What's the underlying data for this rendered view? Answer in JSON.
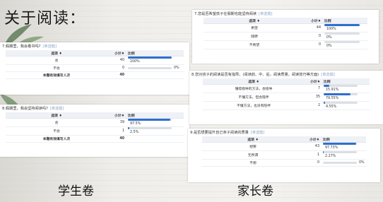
{
  "title": "关于阅读：",
  "captions": {
    "student": "学生卷",
    "parent": "家长卷"
  },
  "student": {
    "q7": {
      "question": "7.假期里，我会看书吗?",
      "tag": "[单选题]",
      "headers": [
        "选项 ♦",
        "小计♦",
        "比例"
      ],
      "rows": [
        {
          "option": "会",
          "count": "40",
          "pct_label": "100%",
          "pct": 100
        },
        {
          "option": "不会",
          "count": "0",
          "pct_label": "0%",
          "pct": 0
        }
      ],
      "total": {
        "label": "本题有效填写人次",
        "count": "40"
      }
    },
    "q8": {
      "question": "8.假期里，我会坚持阅读吗?",
      "tag": "[单选题]",
      "headers": [
        "选项 ♦",
        "小计♦",
        "比例"
      ],
      "rows": [
        {
          "option": "会",
          "count": "39",
          "pct_label": "97.5%",
          "pct": 97.5
        },
        {
          "option": "不会",
          "count": "1",
          "pct_label": "2.5%",
          "pct": 2.5
        }
      ],
      "total": {
        "label": "本题有效填写人次",
        "count": "40"
      }
    }
  },
  "parent": {
    "q7": {
      "question": "7.您是否希望孩子在假期也能坚持阅读",
      "tag": "[单选题]",
      "headers": [
        "选项 ♦",
        "小计♦",
        "比例"
      ],
      "rows": [
        {
          "option": "希望",
          "count": "44",
          "pct_label": "100%",
          "pct": 100
        },
        {
          "option": "随便",
          "count": "0",
          "pct_label": "0%",
          "pct": 0
        },
        {
          "option": "不希望",
          "count": "0",
          "pct_label": "0%",
          "pct": 0
        }
      ]
    },
    "q8": {
      "question": "8.您对孩子的阅读是否有指导。(阅读前、中、后，阅读质量，阅读技巧等方面)",
      "tag": "[单选题]",
      "headers": [
        "选项 ♦",
        "小计♦",
        "比例"
      ],
      "rows": [
        {
          "option": "懂得指导的方法，会指导",
          "count": "7",
          "pct_label": "15.91%",
          "pct": 15.91
        },
        {
          "option": "不懂方法，但会陪伴",
          "count": "35",
          "pct_label": "79.55%",
          "pct": 79.55
        },
        {
          "option": "不懂方法，也没有陪伴",
          "count": "2",
          "pct_label": "4.55%",
          "pct": 4.55
        }
      ]
    },
    "q9": {
      "question": "9.是否想要提升自己亲子阅读的质量",
      "tag": "[单选题]",
      "headers": [
        "选项 ♦",
        "小计♦",
        "比例"
      ],
      "rows": [
        {
          "option": "想要",
          "count": "43",
          "pct_label": "97.73%",
          "pct": 97.73
        },
        {
          "option": "无所谓",
          "count": "1",
          "pct_label": "2.27%",
          "pct": 2.27
        },
        {
          "option": "不想",
          "count": "0",
          "pct_label": "0%",
          "pct": 0
        }
      ]
    }
  }
}
